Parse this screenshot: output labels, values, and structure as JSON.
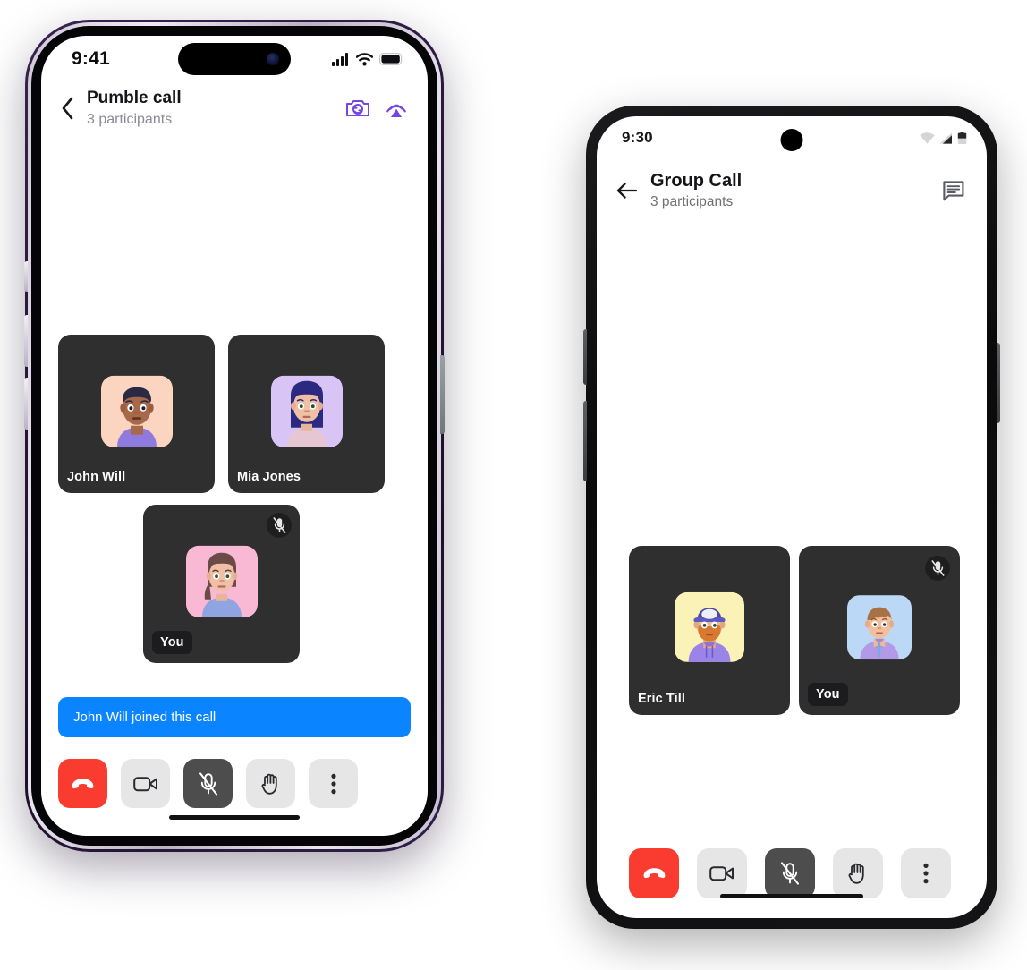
{
  "iphone": {
    "status": {
      "time": "9:41",
      "cellular_icon": "signal-bars-icon",
      "wifi_icon": "wifi-icon",
      "battery_icon": "battery-full-icon",
      "dynamic_island": "dynamic-island"
    },
    "header": {
      "back_icon": "chevron-left-icon",
      "title": "Pumble call",
      "subtitle": "3 participants",
      "actions": [
        {
          "name": "flip-camera-icon",
          "label": "Flip camera",
          "color": "#7445e0"
        },
        {
          "name": "airplay-cast-icon",
          "label": "Cast",
          "color": "#7445e0"
        }
      ]
    },
    "participants": [
      {
        "name": "John Will",
        "label_style": "plain",
        "muted": false,
        "avatar": {
          "bg": "#fbd5c0",
          "hair": "#2b2a45",
          "skin": "#a8694a",
          "shirt": "#8f7ae0",
          "style": "short-hair-man"
        }
      },
      {
        "name": "Mia Jones",
        "label_style": "plain",
        "muted": false,
        "avatar": {
          "bg": "#d8c4f5",
          "hair": "#2b2a80",
          "skin": "#e8b59a",
          "shirt": "#e6c6d2",
          "style": "long-hair-woman"
        }
      },
      {
        "name": "You",
        "label_style": "chip",
        "muted": true,
        "avatar": {
          "bg": "#f9b8d4",
          "hair": "#6b4a47",
          "skin": "#e8b59a",
          "shirt": "#8fa4e0",
          "style": "ponytail-woman"
        }
      }
    ],
    "banner": {
      "text": "John Will joined this call",
      "color": "#0a84ff"
    },
    "controls": [
      {
        "name": "end-call-button",
        "icon": "phone-down-icon",
        "state": "end"
      },
      {
        "name": "camera-toggle-button",
        "icon": "video-camera-icon",
        "state": "default"
      },
      {
        "name": "mic-toggle-button",
        "icon": "mic-off-icon",
        "state": "active"
      },
      {
        "name": "raise-hand-button",
        "icon": "raised-hand-icon",
        "state": "default"
      },
      {
        "name": "more-options-button",
        "icon": "more-vertical-icon",
        "state": "default"
      }
    ],
    "home_indicator": "home-indicator"
  },
  "android": {
    "status": {
      "time": "9:30",
      "wifi_icon": "wifi-icon",
      "cellular_icon": "signal-triangle-icon",
      "battery_icon": "battery-half-icon",
      "camera_cutout": "punch-hole-camera"
    },
    "header": {
      "back_icon": "arrow-left-icon",
      "title": "Group Call",
      "subtitle": "3 participants",
      "actions": [
        {
          "name": "chat-icon",
          "label": "Chat",
          "color": "#5a5a66"
        }
      ]
    },
    "participants": [
      {
        "name": "Eric Till",
        "label_style": "plain",
        "muted": false,
        "avatar": {
          "bg": "#fbf2b8",
          "hair": "#c97a3c",
          "skin": "#e8a77e",
          "shirt": "#9b84e8",
          "cap": "#6a5acd",
          "style": "bearded-man-cap"
        }
      },
      {
        "name": "You",
        "label_style": "chip",
        "muted": true,
        "avatar": {
          "bg": "#bcd8f7",
          "hair": "#a87146",
          "skin": "#efb995",
          "shirt": "#b39ae8",
          "style": "short-hair-man-blue"
        }
      }
    ],
    "controls": [
      {
        "name": "end-call-button",
        "icon": "phone-down-icon",
        "state": "end"
      },
      {
        "name": "camera-toggle-button",
        "icon": "video-camera-icon",
        "state": "default"
      },
      {
        "name": "mic-toggle-button",
        "icon": "mic-off-icon",
        "state": "active"
      },
      {
        "name": "raise-hand-button",
        "icon": "raised-hand-icon",
        "state": "default"
      },
      {
        "name": "more-options-button",
        "icon": "more-vertical-icon",
        "state": "default"
      }
    ],
    "home_indicator": "home-indicator"
  }
}
